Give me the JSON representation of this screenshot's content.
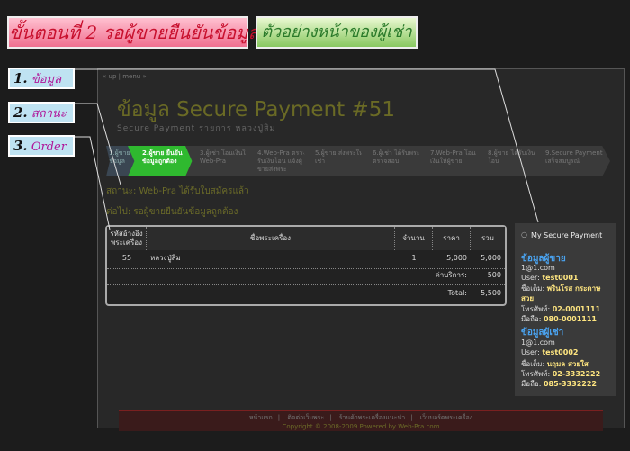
{
  "banners": {
    "step": "ขั้นตอนที่ 2  รอผู้ขายยืนยันข้อมูล",
    "view": "ตัวอย่างหน้าของผู้เช่า"
  },
  "tags": [
    {
      "num": "1.",
      "text": "ข้อมูล"
    },
    {
      "num": "2.",
      "text": "สถานะ"
    },
    {
      "num": "3.",
      "text": "Order"
    }
  ],
  "topmenu": "« up | menu »",
  "title": "ข้อมูล Secure Payment #51",
  "subtitle": "Secure Payment รายการ หลวงปู่สิม",
  "steps": [
    {
      "label": "1.ผู้ขาย รับข้อมูล",
      "state": "done"
    },
    {
      "label": "2.ผู้ขาย ยืนยันข้อมูลถูกต้อง",
      "state": "active"
    },
    {
      "label": "3.ผู้เช่า โอนเงินให้ Web-Pra",
      "state": "todo"
    },
    {
      "label": "4.Web-Pra ตรวจรับเงินโอน แจ้งผู้ขายส่งพระ",
      "state": "todo"
    },
    {
      "label": "5.ผู้ขาย ส่งพระให้ผู้เช่า",
      "state": "todo"
    },
    {
      "label": "6.ผู้เช่า ได้รับพระ ตรวจสอบ",
      "state": "todo"
    },
    {
      "label": "7.Web-Pra โอนเงินให้ผู้ขาย",
      "state": "todo"
    },
    {
      "label": "8.ผู้ขาย ได้รับเงินโอน",
      "state": "todo"
    },
    {
      "label": "9.Secure Payment เสร็จสมบูรณ์",
      "state": "todo"
    }
  ],
  "status": "สถานะ: Web-Pra ได้รับใบสมัครแล้ว",
  "next": "ต่อไป: รอผู้ขายยืนยันข้อมูลถูกต้อง",
  "table": {
    "headers": [
      "รหัสอ้างอิงพระเครื่อง",
      "ชื่อพระเครื่อง",
      "จำนวน",
      "ราคา",
      "รวม"
    ],
    "rows": [
      [
        "55",
        "หลวงปู่สิม",
        "1",
        "5,000",
        "5,000"
      ]
    ],
    "fee_label": "ค่าบริการ:",
    "fee_value": "500",
    "total_label": "Total:",
    "total_value": "5,500"
  },
  "sidebar": {
    "link": "My Secure Payment",
    "seller": {
      "heading": "ข้อมูลผู้ขาย",
      "email": "1@1.com",
      "user_label": "User:",
      "user": "test0001",
      "name_label": "ชื่อเต็ม:",
      "name": "พรินโรส กระดาษสวย",
      "phone_label": "โทรศัพท์:",
      "phone": "02-0001111",
      "mobile_label": "มือถือ:",
      "mobile": "080-0001111"
    },
    "buyer": {
      "heading": "ข้อมูลผู้เช่า",
      "email": "1@1.com",
      "user_label": "User:",
      "user": "test0002",
      "name_label": "ชื่อเต็ม:",
      "name": "นฤมล สวยใส",
      "phone_label": "โทรศัพท์:",
      "phone": "02-3332222",
      "mobile_label": "มือถือ:",
      "mobile": "085-3332222"
    }
  },
  "footer": {
    "links": [
      "หน้าแรก",
      "ติดต่อเว็บพระ",
      "ร้านค้าพระเครื่องแนะนำ",
      "เว็บบอร์ดพระเครื่อง"
    ],
    "copyright": "Copyright © 2008-2009 Powered by Web-Pra.com"
  }
}
